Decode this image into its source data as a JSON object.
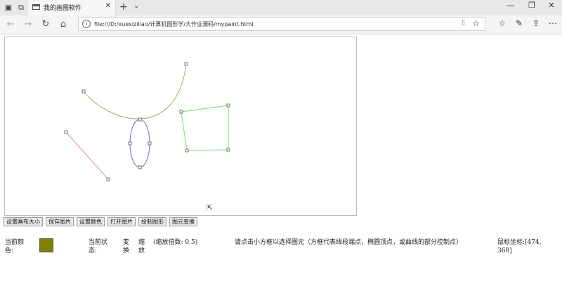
{
  "browser": {
    "tab_title": "我的画图软件",
    "url": "file:///D:/xuexiziliao/计算机图形学/大作业源码/mypaint.html"
  },
  "buttons": [
    "设置画布大小",
    "保存图片",
    "设置颜色",
    "打开图片",
    "绘制图形",
    "图元变换"
  ],
  "status": {
    "color_label": "当前颜色:",
    "current_color": "#808000",
    "state_label": "当前状态:",
    "state_value": "变换",
    "zoom_value": "缩放",
    "zoom_note": "(缩放倍数: 0.5)",
    "hint": "请点击小方框以选择图元（方框代表线段端点，椭圆顶点，或曲线的部分控制点）",
    "mouse_label": "鼠标坐标:",
    "mouse_coords": "[474, 368]"
  },
  "colors": {
    "line": "#e89090",
    "curve": "#a8a860",
    "ellipse": "#6a6acc",
    "polygon": "#70e070"
  },
  "icons": [
    "tab-grid-icon",
    "tab-back-icon",
    "page-icon",
    "close-icon",
    "new-tab-icon",
    "chevron-down-icon",
    "minimize-icon",
    "maximize-icon",
    "window-close-icon",
    "back-icon",
    "forward-icon",
    "refresh-icon",
    "home-icon",
    "info-icon",
    "reading-view-icon",
    "favorite-star-icon",
    "favorites-hub-icon",
    "pen-icon",
    "share-icon",
    "more-icon",
    "mouse-cursor-icon"
  ]
}
